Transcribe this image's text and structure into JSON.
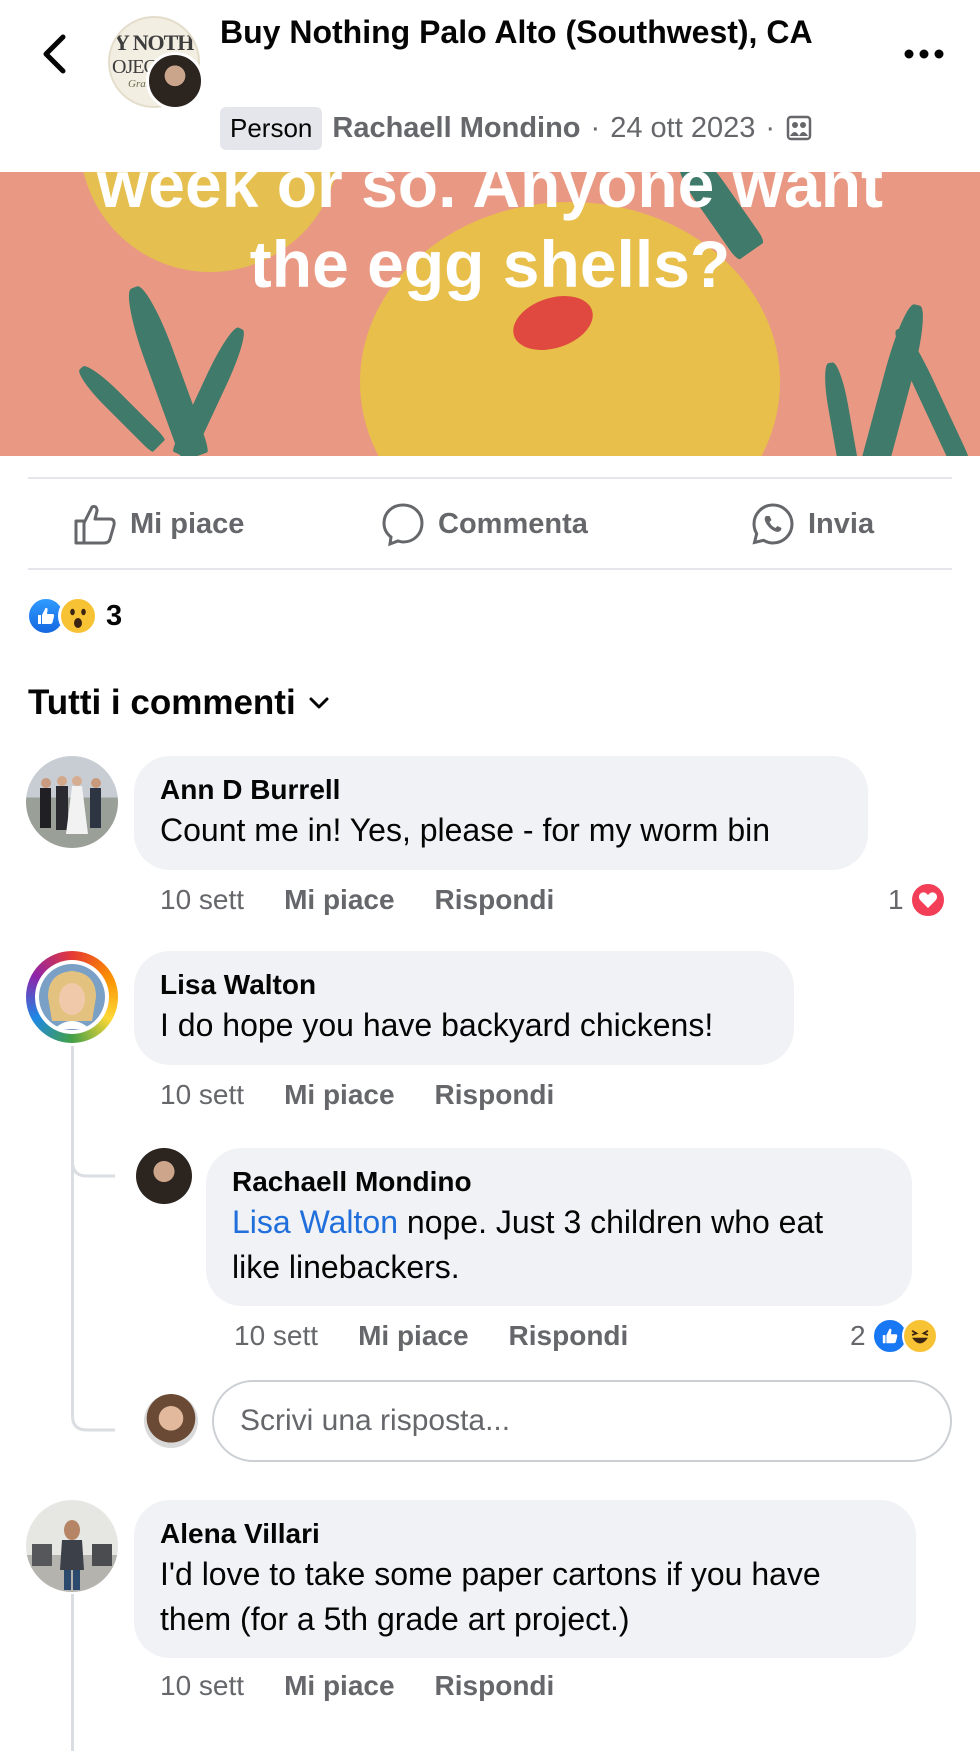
{
  "header": {
    "group_title": "Buy Nothing Palo Alto (Southwest), CA",
    "badge": "Person",
    "author": "Rachaell Mondino",
    "separator": "·",
    "date": "24 ott 2023",
    "logo_line1": "Y NOTH",
    "logo_line2": "OJECT",
    "logo_line3": "Gratitu"
  },
  "banner": {
    "line1": "week or so. Anyone want",
    "line2": "the egg shells?"
  },
  "actions": {
    "like": "Mi piace",
    "comment": "Commenta",
    "send": "Invia"
  },
  "reactions": {
    "count": "3"
  },
  "sort": {
    "label": "Tutti i commenti"
  },
  "comments": [
    {
      "author": "Ann D Burrell",
      "text": "Count me in!  Yes, please - for my worm bin",
      "time": "10 sett",
      "like": "Mi piace",
      "reply": "Rispondi",
      "reaction_count": "1"
    },
    {
      "author": "Lisa Walton",
      "text": "I do hope you have backyard chickens!",
      "time": "10 sett",
      "like": "Mi piace",
      "reply": "Rispondi",
      "replies": [
        {
          "author": "Rachaell Mondino",
          "mention": "Lisa Walton",
          "text_line1": " nope. Just 3 children who eat",
          "text_line2": "like linebackers.",
          "time": "10 sett",
          "like": "Mi piace",
          "reply": "Rispondi",
          "reaction_count": "2"
        }
      ]
    },
    {
      "author": "Alena Villari",
      "text_line1": "I'd love to take some paper cartons if you have",
      "text_line2": "them (for a 5th grade art project.)",
      "time": "10 sett",
      "like": "Mi piace",
      "reply": "Rispondi"
    }
  ],
  "reply_input": {
    "placeholder": "Scrivi una risposta..."
  },
  "colors": {
    "link": "#216fdb",
    "muted": "#65676b",
    "bubble": "#f0f2f5",
    "banner_bg": "#e99983",
    "like_blue": "#1877f2",
    "heart_red": "#f33e58"
  }
}
